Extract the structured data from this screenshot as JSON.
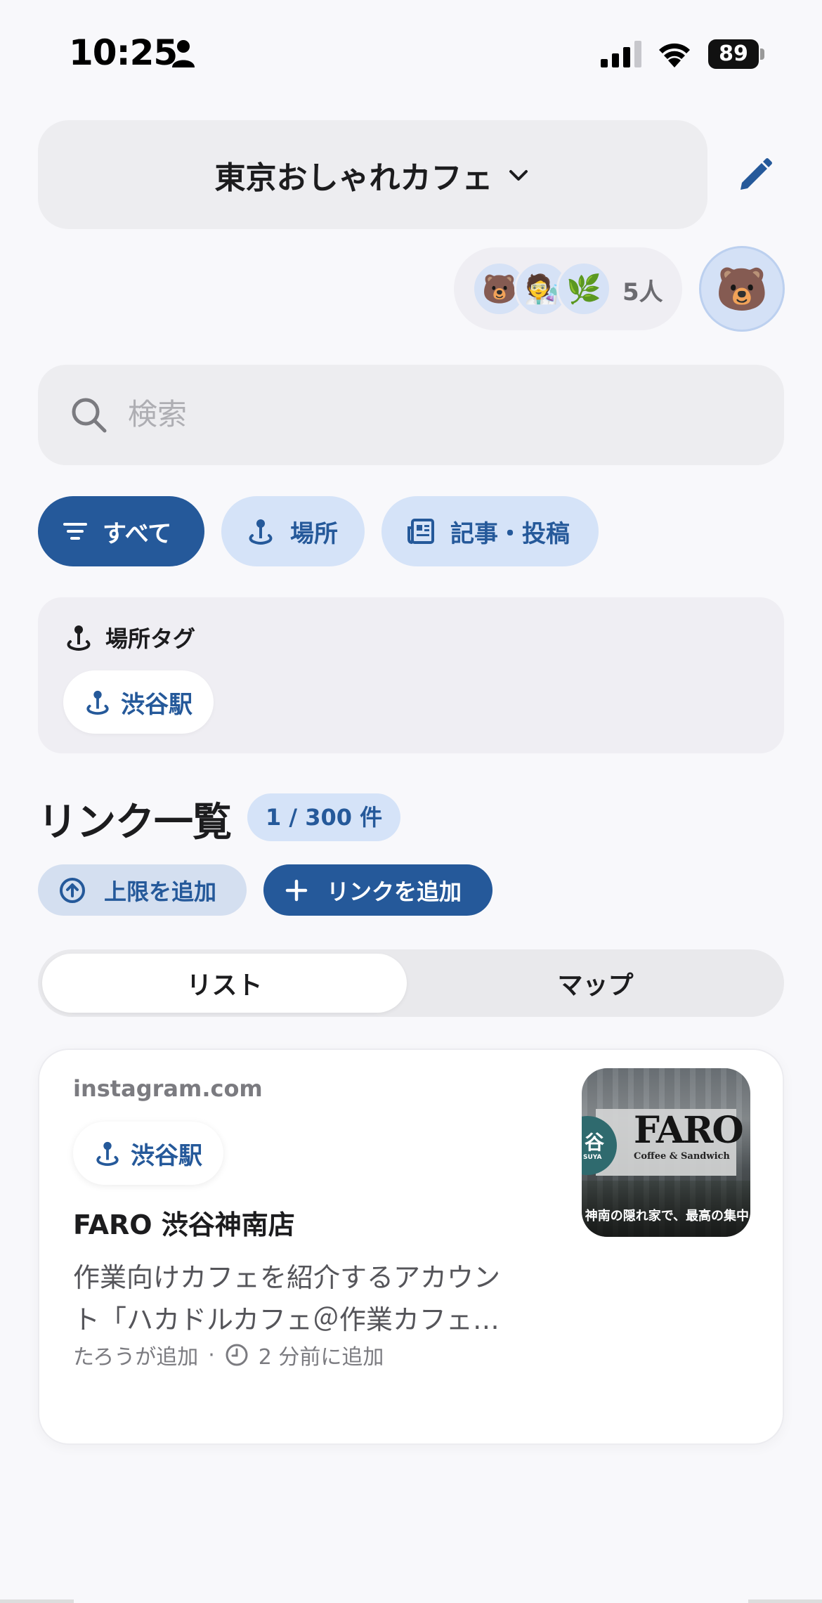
{
  "status_bar": {
    "time": "10:25",
    "battery": "89"
  },
  "header": {
    "title": "東京おしゃれカフェ",
    "title_icon": "chevron-down-icon",
    "edit_icon": "pencil-icon"
  },
  "members": {
    "avatars": [
      "🐻",
      "🧑‍🔬",
      "🌿"
    ],
    "count_label": "5人",
    "my_avatar": "🐻"
  },
  "search": {
    "placeholder": "検索"
  },
  "filters": {
    "all": "すべて",
    "place": "場所",
    "article": "記事・投稿"
  },
  "place_tags": {
    "title": "場所タグ",
    "items": [
      "渋谷駅"
    ]
  },
  "link_list": {
    "title": "リンク一覧",
    "count": "1 / 300 件",
    "limit_button": "上限を追加",
    "add_button": "リンクを追加"
  },
  "view_toggle": {
    "list": "リスト",
    "map": "マップ",
    "selected": "リスト"
  },
  "cards": [
    {
      "domain": "instagram.com",
      "tag": "渋谷駅",
      "title": "FARO 渋谷神南店",
      "desc_line1": "作業向けカフェを紹介するアカウン",
      "desc_line2": "ト「ハカドルカフェ＠作業カフェ…",
      "added_by": "たろうが追加",
      "separator": "·",
      "added_time": "2 分前に追加",
      "thumb_brand": "FARO",
      "thumb_sub": "Coffee & Sandwich",
      "thumb_circle": "谷",
      "thumb_circle_sub": "SUYA",
      "thumb_caption": "神南の隠れ家で、最高の集中"
    }
  ],
  "colors": {
    "accent": "#25599a",
    "accent_light": "#d5e3f8",
    "background": "#f8f8fb"
  }
}
